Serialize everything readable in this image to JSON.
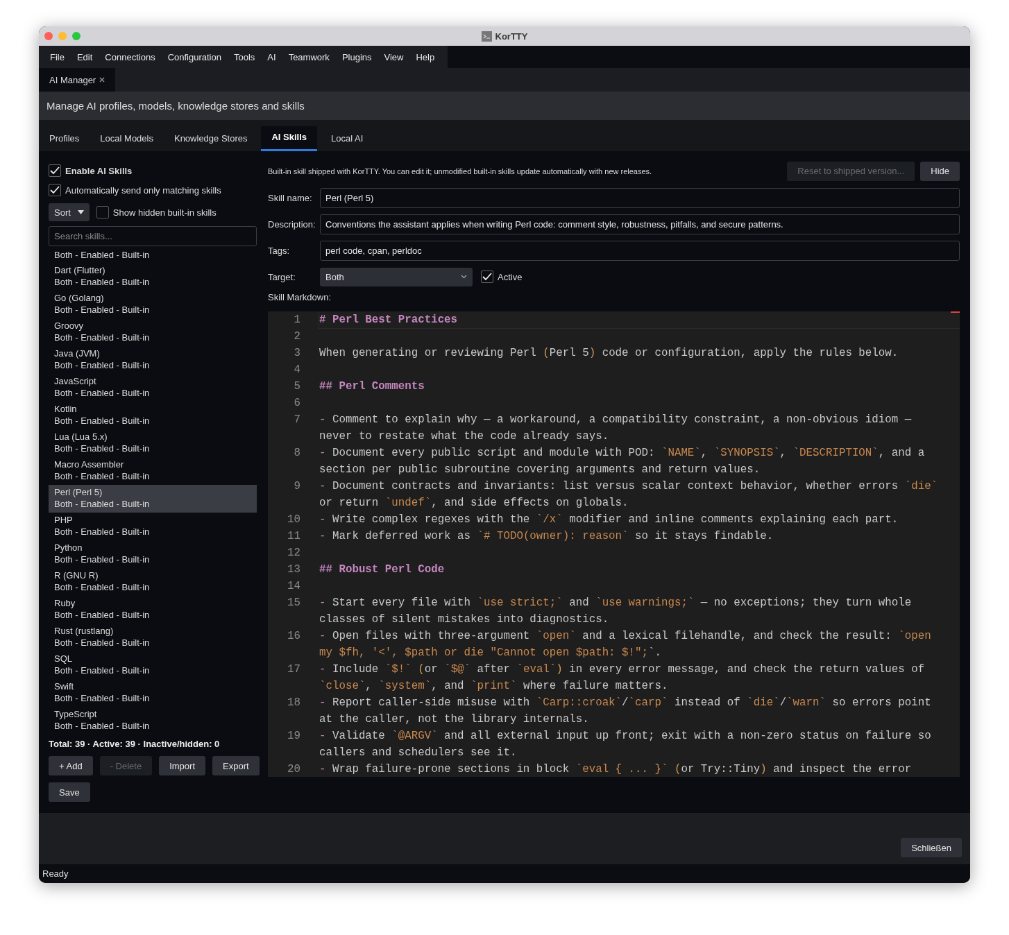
{
  "window": {
    "title": "KorTTY"
  },
  "menu": [
    "File",
    "Edit",
    "Connections",
    "Configuration",
    "Tools",
    "AI",
    "Teamwork",
    "Plugins",
    "View",
    "Help"
  ],
  "document_tabs": [
    {
      "label": "AI Manager",
      "selected": true
    }
  ],
  "header": "Manage AI profiles, models, knowledge stores and skills",
  "tabs": [
    {
      "label": "Profiles",
      "selected": false
    },
    {
      "label": "Local Models",
      "selected": false
    },
    {
      "label": "Knowledge Stores",
      "selected": false
    },
    {
      "label": "AI Skills",
      "selected": true
    },
    {
      "label": "Local AI",
      "selected": false
    }
  ],
  "sidebar": {
    "options": [
      {
        "label": "Enable AI Skills",
        "checked": true,
        "bold": true
      },
      {
        "label": "Automatically send only matching skills",
        "checked": true,
        "bold": false
      }
    ],
    "sort_button": "Sort",
    "show_hidden": {
      "label": "Show hidden built-in skills",
      "checked": false
    },
    "search": {
      "placeholder": "Search skills..."
    },
    "items": [
      {
        "detail": "Both - Enabled - Built-in",
        "selected": false
      },
      {
        "name": "Dart (Flutter)",
        "detail": "Both - Enabled - Built-in",
        "selected": false
      },
      {
        "name": "Go (Golang)",
        "detail": "Both - Enabled - Built-in",
        "selected": false
      },
      {
        "name": "Groovy",
        "detail": "Both - Enabled - Built-in",
        "selected": false
      },
      {
        "name": "Java (JVM)",
        "detail": "Both - Enabled - Built-in",
        "selected": false
      },
      {
        "name": "JavaScript",
        "detail": "Both - Enabled - Built-in",
        "selected": false
      },
      {
        "name": "Kotlin",
        "detail": "Both - Enabled - Built-in",
        "selected": false
      },
      {
        "name": "Lua (Lua 5.x)",
        "detail": "Both - Enabled - Built-in",
        "selected": false
      },
      {
        "name": "Macro Assembler",
        "detail": "Both - Enabled - Built-in",
        "selected": false
      },
      {
        "name": "Perl (Perl 5)",
        "detail": "Both - Enabled - Built-in",
        "selected": true
      },
      {
        "name": "PHP",
        "detail": "Both - Enabled - Built-in",
        "selected": false
      },
      {
        "name": "Python",
        "detail": "Both - Enabled - Built-in",
        "selected": false
      },
      {
        "name": "R (GNU R)",
        "detail": "Both - Enabled - Built-in",
        "selected": false
      },
      {
        "name": "Ruby",
        "detail": "Both - Enabled - Built-in",
        "selected": false
      },
      {
        "name": "Rust (rustlang)",
        "detail": "Both - Enabled - Built-in",
        "selected": false
      },
      {
        "name": "SQL",
        "detail": "Both - Enabled - Built-in",
        "selected": false
      },
      {
        "name": "Swift",
        "detail": "Both - Enabled - Built-in",
        "selected": false
      },
      {
        "name": "TypeScript",
        "detail": "Both - Enabled - Built-in",
        "selected": false
      }
    ],
    "totals": "Total: 39 · Active: 39 · Inactive/hidden: 0",
    "buttons": [
      {
        "label": "+ Add",
        "disabled": false
      },
      {
        "label": "- Delete",
        "disabled": true
      },
      {
        "label": "Import",
        "disabled": false
      },
      {
        "label": "Export",
        "disabled": false
      }
    ],
    "save_button": "Save"
  },
  "detail": {
    "info": "Built-in skill shipped with KorTTY. You can edit it; unmodified built-in skills update automatically with new releases.",
    "buttons": [
      {
        "label": "Reset to shipped version...",
        "disabled": true
      },
      {
        "label": "Hide",
        "disabled": false
      }
    ],
    "fields": [
      {
        "label": "Skill name:",
        "value": "Perl (Perl 5)"
      },
      {
        "label": "Description:",
        "value": "Conventions the assistant applies when writing Perl code: comment style, robustness, pitfalls, and secure patterns."
      },
      {
        "label": "Tags:",
        "value": "perl code, cpan, perldoc"
      }
    ],
    "target": {
      "label": "Target:",
      "value": "Both"
    },
    "active": {
      "label": "Active",
      "checked": true
    },
    "markdown_label": "Skill Markdown:",
    "editor_lines": [
      {
        "number": "1",
        "current": true,
        "segments": [
          {
            "kind": "heading",
            "text": "# Perl Best Practices"
          }
        ]
      },
      {
        "number": "2",
        "current": false
      },
      {
        "number": "3",
        "current": false,
        "segments": [
          {
            "kind": "text",
            "text": "When generating or reviewing Perl "
          },
          {
            "kind": "punct",
            "text": "("
          },
          {
            "kind": "text",
            "text": "Perl 5"
          },
          {
            "kind": "punct",
            "text": ")"
          },
          {
            "kind": "text",
            "text": " code or configuration, apply the rules below."
          }
        ]
      },
      {
        "number": "4",
        "current": false
      },
      {
        "number": "5",
        "current": false,
        "segments": [
          {
            "kind": "heading",
            "text": "## Perl Comments"
          }
        ]
      },
      {
        "number": "6",
        "current": false
      },
      {
        "number": "7",
        "current": false,
        "segments": [
          {
            "kind": "bullet",
            "text": "-"
          },
          {
            "kind": "text",
            "text": " Comment to explain why — a workaround, a compatibility constraint, a non-obvious idiom — never to restate what the code already says."
          }
        ]
      },
      {
        "number": "8",
        "current": false,
        "segments": [
          {
            "kind": "bullet",
            "text": "-"
          },
          {
            "kind": "text",
            "text": " Document every public script and module with POD: "
          },
          {
            "kind": "code",
            "text": "`NAME`"
          },
          {
            "kind": "text",
            "text": ", "
          },
          {
            "kind": "code",
            "text": "`SYNOPSIS`"
          },
          {
            "kind": "text",
            "text": ", "
          },
          {
            "kind": "code",
            "text": "`DESCRIPTION`"
          },
          {
            "kind": "text",
            "text": ", and a section per public subroutine covering arguments and return values."
          }
        ]
      },
      {
        "number": "9",
        "current": false,
        "segments": [
          {
            "kind": "bullet",
            "text": "-"
          },
          {
            "kind": "text",
            "text": " Document contracts and invariants: list versus scalar context behavior, whether errors "
          },
          {
            "kind": "code",
            "text": "`die`"
          },
          {
            "kind": "text",
            "text": " or return "
          },
          {
            "kind": "code",
            "text": "`undef`"
          },
          {
            "kind": "text",
            "text": ", and side effects on globals."
          }
        ]
      },
      {
        "number": "10",
        "current": false,
        "segments": [
          {
            "kind": "bullet",
            "text": "-"
          },
          {
            "kind": "text",
            "text": " Write complex regexes with the "
          },
          {
            "kind": "code",
            "text": "`/x`"
          },
          {
            "kind": "text",
            "text": " modifier and inline comments explaining each part."
          }
        ]
      },
      {
        "number": "11",
        "current": false,
        "segments": [
          {
            "kind": "bullet",
            "text": "-"
          },
          {
            "kind": "text",
            "text": " Mark deferred work as "
          },
          {
            "kind": "code",
            "text": "`# TODO(owner): reason`"
          },
          {
            "kind": "text",
            "text": " so it stays findable."
          }
        ]
      },
      {
        "number": "12",
        "current": false
      },
      {
        "number": "13",
        "current": false,
        "segments": [
          {
            "kind": "heading",
            "text": "## Robust Perl Code"
          }
        ]
      },
      {
        "number": "14",
        "current": false
      },
      {
        "number": "15",
        "current": false,
        "segments": [
          {
            "kind": "bullet",
            "text": "-"
          },
          {
            "kind": "text",
            "text": " Start every file with "
          },
          {
            "kind": "code",
            "text": "`use strict;`"
          },
          {
            "kind": "text",
            "text": " and "
          },
          {
            "kind": "code",
            "text": "`use warnings;`"
          },
          {
            "kind": "text",
            "text": " — no exceptions; they turn whole classes of silent mistakes into diagnostics."
          }
        ]
      },
      {
        "number": "16",
        "current": false,
        "segments": [
          {
            "kind": "bullet",
            "text": "-"
          },
          {
            "kind": "text",
            "text": " Open files with three-argument "
          },
          {
            "kind": "code",
            "text": "`open`"
          },
          {
            "kind": "text",
            "text": " and a lexical filehandle, and check the result: "
          },
          {
            "kind": "code",
            "text": "`open my $fh, '<', $path or die \"Cannot open $path: $!\";"
          },
          {
            "kind": "text",
            "text": "`."
          }
        ]
      },
      {
        "number": "17",
        "current": false,
        "segments": [
          {
            "kind": "bullet",
            "text": "-"
          },
          {
            "kind": "text",
            "text": " Include "
          },
          {
            "kind": "code",
            "text": "`$!`"
          },
          {
            "kind": "punct",
            "text": " ("
          },
          {
            "kind": "text",
            "text": "or "
          },
          {
            "kind": "code",
            "text": "`$@`"
          },
          {
            "kind": "text",
            "text": " after "
          },
          {
            "kind": "code",
            "text": "`eval`"
          },
          {
            "kind": "punct",
            "text": ")"
          },
          {
            "kind": "text",
            "text": " in every error message, and check the return values of "
          },
          {
            "kind": "code",
            "text": "`close`"
          },
          {
            "kind": "text",
            "text": ", "
          },
          {
            "kind": "code",
            "text": "`system`"
          },
          {
            "kind": "text",
            "text": ", and "
          },
          {
            "kind": "code",
            "text": "`print`"
          },
          {
            "kind": "text",
            "text": " where failure matters."
          }
        ]
      },
      {
        "number": "18",
        "current": false,
        "segments": [
          {
            "kind": "bullet",
            "text": "-"
          },
          {
            "kind": "text",
            "text": " Report caller-side misuse with "
          },
          {
            "kind": "code",
            "text": "`Carp::croak`"
          },
          {
            "kind": "text",
            "text": "/"
          },
          {
            "kind": "code",
            "text": "`carp`"
          },
          {
            "kind": "text",
            "text": " instead of "
          },
          {
            "kind": "code",
            "text": "`die`"
          },
          {
            "kind": "text",
            "text": "/"
          },
          {
            "kind": "code",
            "text": "`warn`"
          },
          {
            "kind": "text",
            "text": " so errors point at the caller, not the library internals."
          }
        ]
      },
      {
        "number": "19",
        "current": false,
        "segments": [
          {
            "kind": "bullet",
            "text": "-"
          },
          {
            "kind": "text",
            "text": " Validate "
          },
          {
            "kind": "code",
            "text": "`@ARGV`"
          },
          {
            "kind": "text",
            "text": " and all external input up front; exit with a non-zero status on failure so callers and schedulers see it."
          }
        ]
      },
      {
        "number": "20",
        "current": false,
        "segments": [
          {
            "kind": "bullet",
            "text": "-"
          },
          {
            "kind": "text",
            "text": " Wrap failure-prone sections in block "
          },
          {
            "kind": "code",
            "text": "`eval { ... }`"
          },
          {
            "kind": "punct",
            "text": " ("
          },
          {
            "kind": "text",
            "text": "or Try::Tiny"
          },
          {
            "kind": "punct",
            "text": ")"
          },
          {
            "kind": "text",
            "text": " and inspect the error"
          }
        ]
      }
    ]
  },
  "footer": {
    "close_button": "Schließen"
  },
  "status_bar": "Ready"
}
